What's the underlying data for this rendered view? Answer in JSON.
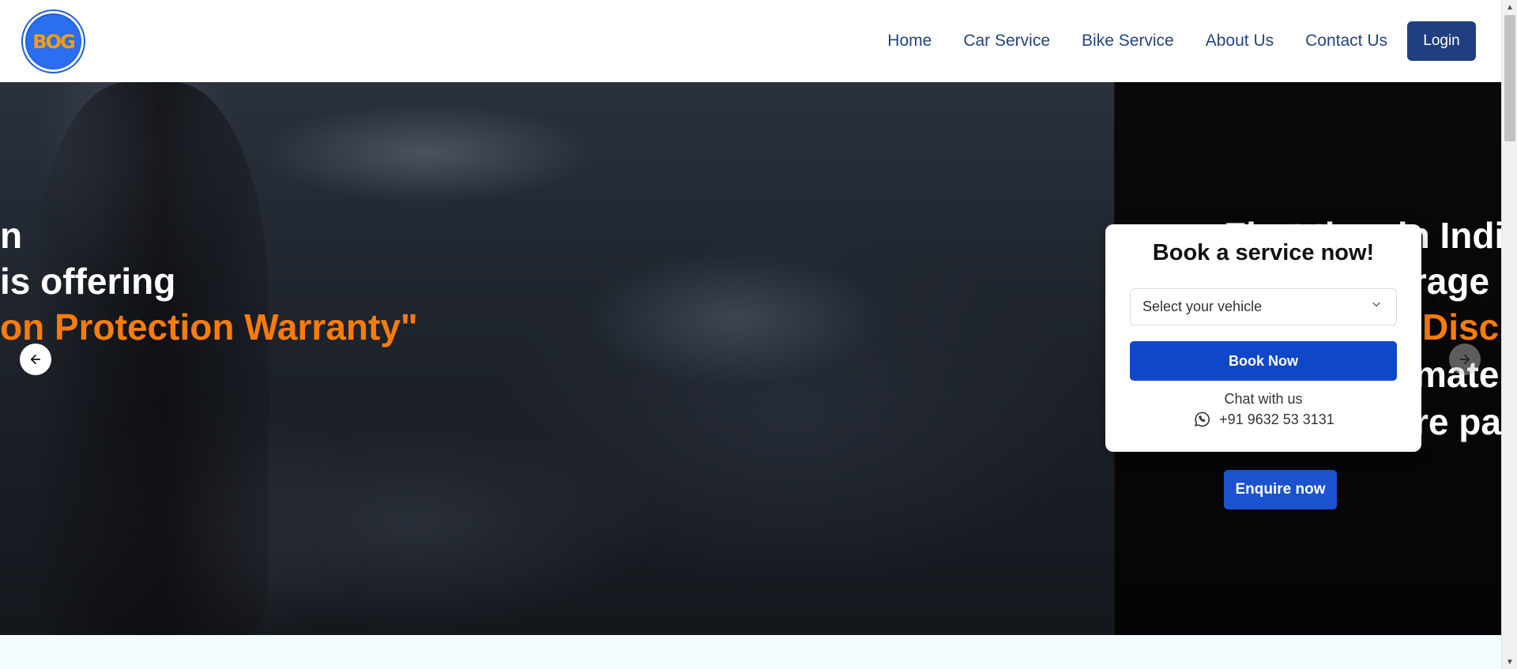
{
  "logo": {
    "text": "BOG"
  },
  "nav": {
    "items": [
      "Home",
      "Car Service",
      "Bike Service",
      "About Us",
      "Contact Us"
    ],
    "login": "Login"
  },
  "hero": {
    "left": {
      "line1": "n",
      "line2": "is offering",
      "line3": "on Protection Warranty\""
    },
    "right": {
      "line1": "First time in Indi",
      "line2": "rrage",
      "line3": "Disc",
      "line4": "mate",
      "line5": "re pa"
    },
    "enquire": "Enquire now"
  },
  "booking": {
    "title": "Book a service now!",
    "select_placeholder": "Select your vehicle",
    "button": "Book Now",
    "chat_label": "Chat with us",
    "phone": "+91 9632 53 3131"
  },
  "colors": {
    "accent": "#f97c0a",
    "primary": "#0f48c7",
    "nav_text": "#24457f",
    "login_bg": "#1f3f7f"
  },
  "icons": {
    "prev": "arrow-left-icon",
    "next": "arrow-right-icon",
    "select": "chevron-down-icon",
    "chat": "whatsapp-icon"
  }
}
